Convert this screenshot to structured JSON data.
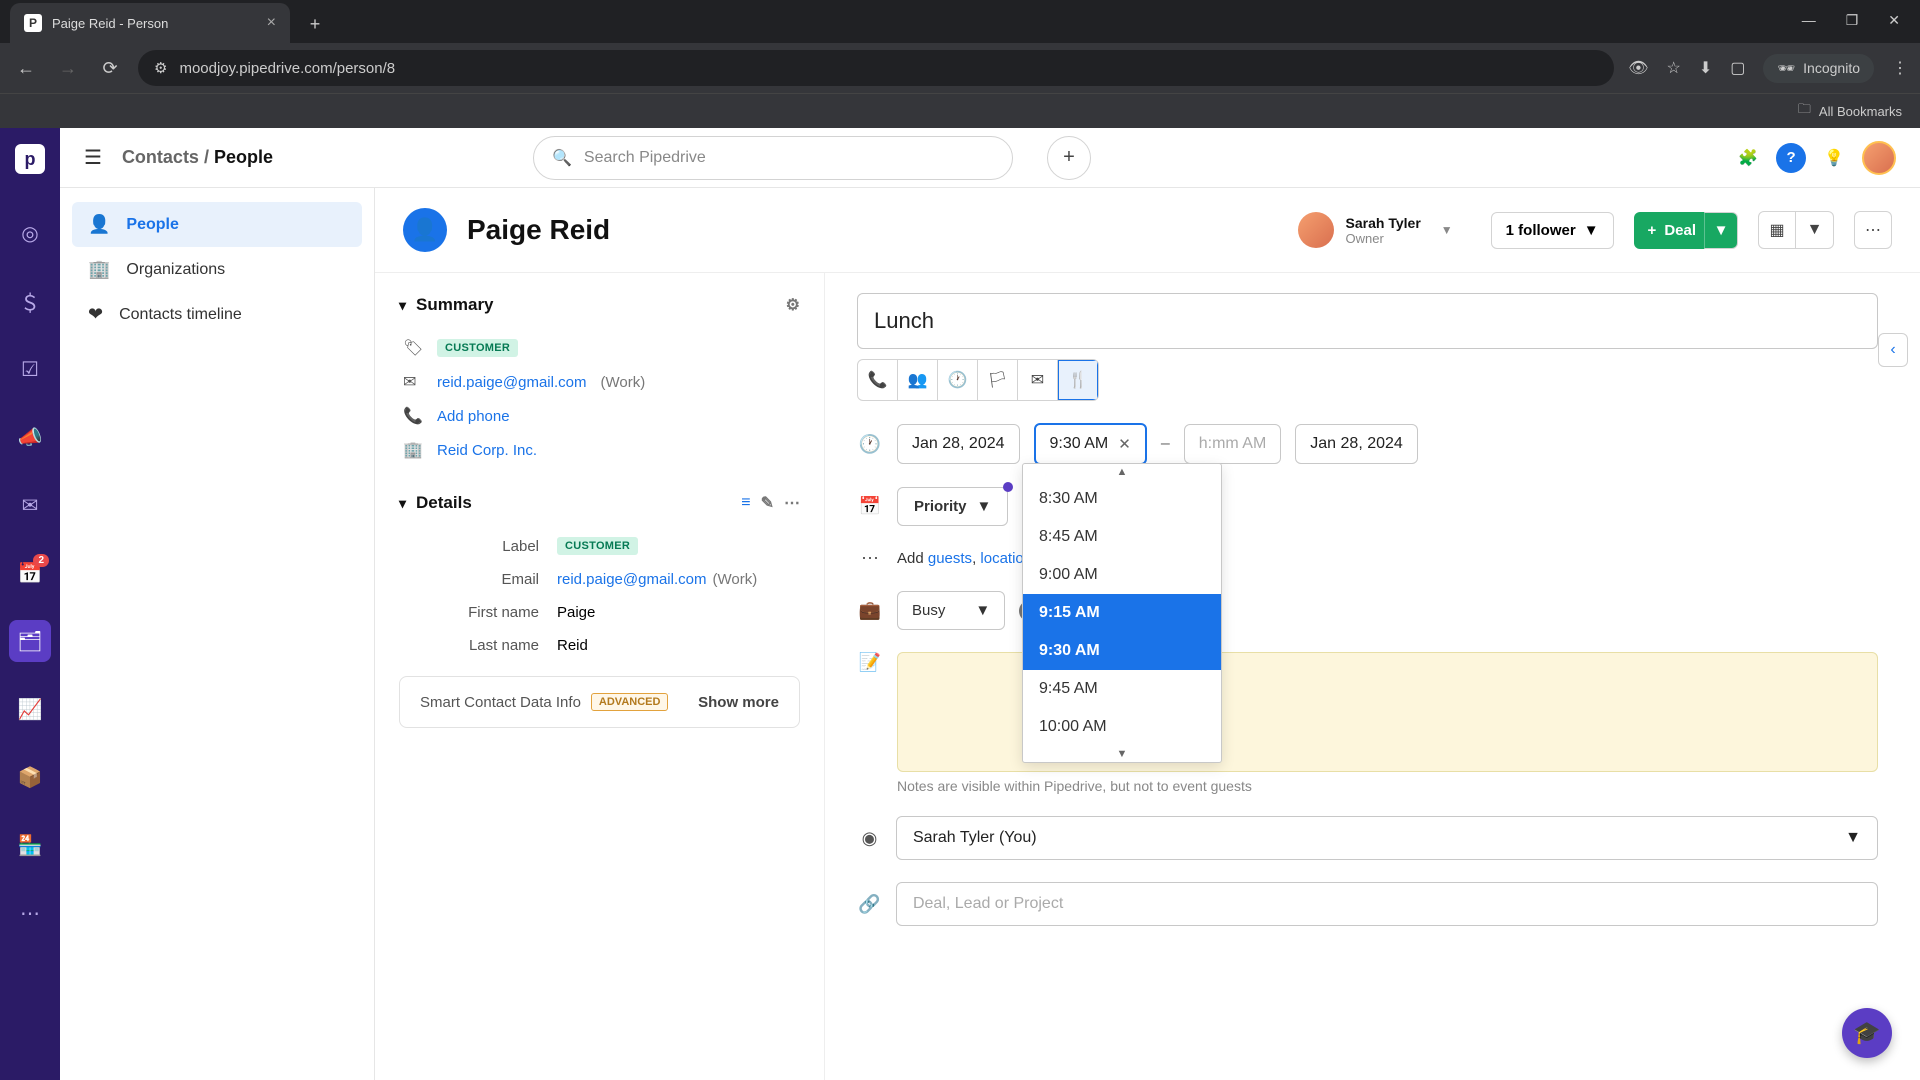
{
  "browser": {
    "tab_title": "Paige Reid - Person",
    "url": "moodjoy.pipedrive.com/person/8",
    "incognito_label": "Incognito",
    "bookmarks_label": "All Bookmarks"
  },
  "topbar": {
    "breadcrumb_parent": "Contacts",
    "breadcrumb_sep": " / ",
    "breadcrumb_current": "People",
    "search_placeholder": "Search Pipedrive"
  },
  "sidebar": {
    "items": [
      {
        "icon": "👤",
        "label": "People",
        "active": true
      },
      {
        "icon": "🏢",
        "label": "Organizations",
        "active": false
      },
      {
        "icon": "❤",
        "label": "Contacts timeline",
        "active": false
      }
    ]
  },
  "rail": {
    "badge_count": "2"
  },
  "contact": {
    "name": "Paige Reid",
    "owner_name": "Sarah Tyler",
    "owner_role": "Owner",
    "follower_label": "1 follower",
    "deal_label": "Deal"
  },
  "summary": {
    "title": "Summary",
    "tag": "CUSTOMER",
    "email": "reid.paige@gmail.com",
    "email_type": "(Work)",
    "add_phone": "Add phone",
    "org": "Reid Corp. Inc."
  },
  "details": {
    "title": "Details",
    "rows": [
      {
        "label": "Label",
        "value": "CUSTOMER",
        "is_tag": true
      },
      {
        "label": "Email",
        "value": "reid.paige@gmail.com",
        "suffix": "(Work)",
        "is_link": true
      },
      {
        "label": "First name",
        "value": "Paige"
      },
      {
        "label": "Last name",
        "value": "Reid"
      }
    ],
    "smart_label": "Smart Contact Data Info",
    "smart_badge": "ADVANCED",
    "show_more": "Show more"
  },
  "activity": {
    "title": "Lunch",
    "start_date": "Jan 28, 2024",
    "start_time": "9:30 AM",
    "end_time_placeholder": "h:mm AM",
    "end_date": "Jan 28, 2024",
    "priority_label": "Priority",
    "add_prefix": "Add ",
    "add_guests": "guests",
    "add_sep": ", ",
    "add_location": "location",
    "busy_label": "Busy",
    "notes_hint": "Notes are visible within Pipedrive, but not to event guests",
    "assignee": "Sarah Tyler (You)",
    "deal_lead_placeholder": "Deal, Lead or Project",
    "time_options": [
      "8:30 AM",
      "8:45 AM",
      "9:00 AM",
      "9:15 AM",
      "9:30 AM",
      "9:45 AM",
      "10:00 AM"
    ]
  }
}
